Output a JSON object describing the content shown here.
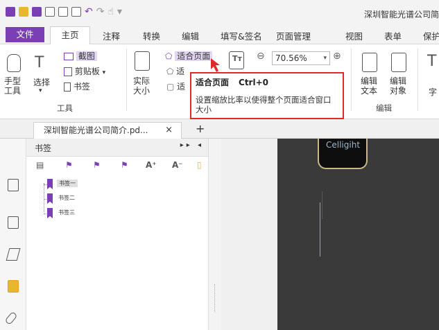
{
  "window": {
    "title": "深圳智能光谱公司简"
  },
  "tabs": [
    "文件",
    "主页",
    "注释",
    "转换",
    "编辑",
    "填写&签名",
    "页面管理",
    "视图",
    "表单",
    "保护"
  ],
  "ribbon": {
    "hand_tool": "手型\n工具",
    "select_tool": "选择",
    "screenshot": "截图",
    "clipboard": "剪贴板",
    "bookmark": "书签",
    "tools_group": "工具",
    "actual_size": "实际\n大小",
    "fit_page": "适合页面",
    "fit_width": "适",
    "fit_visible": "适",
    "zoom_value": "70.56%",
    "edit_text": "编辑\n文本",
    "edit_object": "编辑\n对象",
    "edit_group": "编辑",
    "typewriter_partial": "字"
  },
  "tooltip": {
    "title": "适合页面",
    "shortcut": "Ctrl+0",
    "description": "设置缩放比率以使得整个页面适合窗口大小"
  },
  "document_tab": {
    "name": "深圳智能光谱公司简介.pd...",
    "close": "×",
    "new": "+"
  },
  "bookmarks": {
    "title": "书签",
    "controls": "▸▸ ◂",
    "items": [
      "书签一",
      "书签二",
      "书签三"
    ]
  },
  "page": {
    "logo_text": "Celligiht"
  },
  "colors": {
    "accent": "#7a3fb5",
    "tooltip_border": "#e02a2a",
    "page_bg": "#3a3a3a"
  }
}
